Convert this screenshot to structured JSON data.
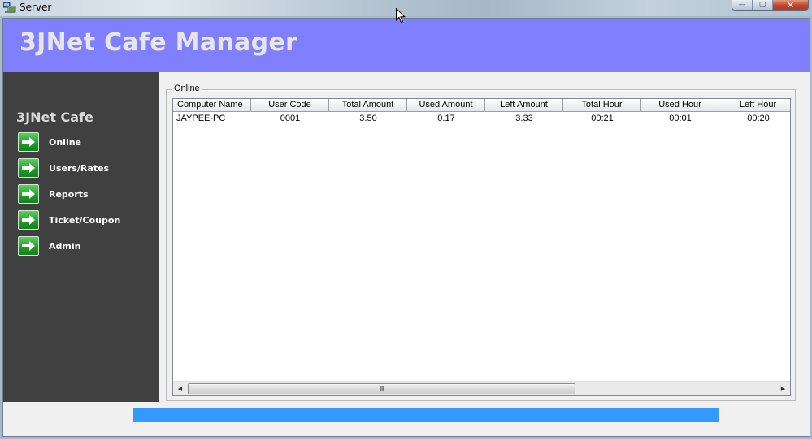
{
  "window": {
    "title": "Server",
    "icon": "server-computer-icon",
    "buttons": {
      "minimize": "minimize-icon",
      "maximize": "maximize-icon",
      "close": "close-icon"
    }
  },
  "header": {
    "title": "3JNet Cafe Manager",
    "background_color": "#8080ff"
  },
  "sidebar": {
    "title": "3JNet Cafe",
    "background_color": "#404040",
    "items": [
      {
        "label": "Online",
        "icon": "green-arrow-right-icon"
      },
      {
        "label": "Users/Rates",
        "icon": "green-arrow-right-icon"
      },
      {
        "label": "Reports",
        "icon": "green-arrow-right-icon"
      },
      {
        "label": "Ticket/Coupon",
        "icon": "green-arrow-right-icon"
      },
      {
        "label": "Admin",
        "icon": "green-arrow-right-icon"
      }
    ]
  },
  "main": {
    "group_label": "Online",
    "table": {
      "columns": [
        "Computer Name",
        "User Code",
        "Total Amount",
        "Used Amount",
        "Left Amount",
        "Total Hour",
        "Used Hour",
        "Left Hour"
      ],
      "rows": [
        [
          "JAYPEE-PC",
          "0001",
          "3.50",
          "0.17",
          "3.33",
          "00:21",
          "00:01",
          "00:20"
        ]
      ]
    },
    "scrollbar": {
      "left_arrow": "◀",
      "right_arrow": "▶",
      "grip": "III"
    }
  },
  "progress": {
    "value_percent": 100,
    "color": "#3399ff"
  },
  "window_glyphs": {
    "minimize": "—",
    "maximize": "▢",
    "close": "✕"
  }
}
